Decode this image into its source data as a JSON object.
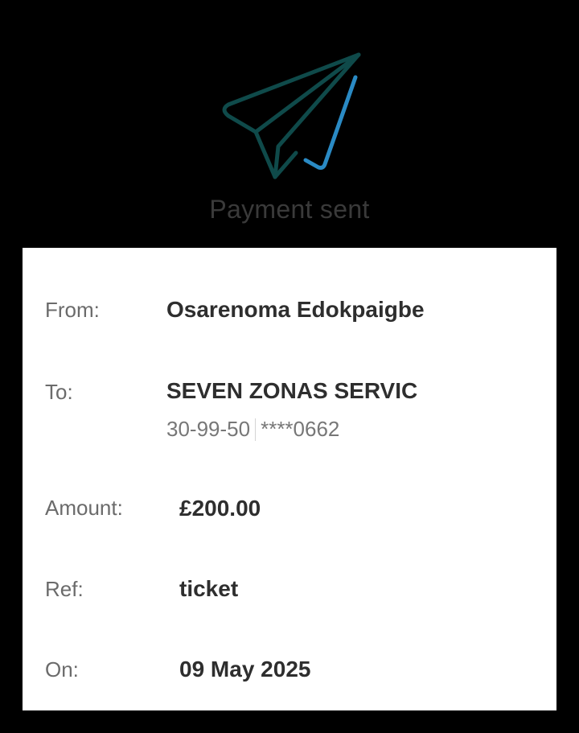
{
  "header": {
    "title": "Payment sent",
    "icon": "paper-plane-check-icon",
    "colors": {
      "plane": "#0f4a4a",
      "check": "#2a8ac4"
    }
  },
  "details": {
    "from_label": "From:",
    "from_value": "Osarenoma Edokpaigbe",
    "to_label": "To:",
    "to_value": "SEVEN ZONAS SERVIC",
    "sort_code": "30-99-50",
    "account_masked": "****0662",
    "amount_label": "Amount:",
    "amount_value": "£200.00",
    "ref_label": "Ref:",
    "ref_value": "ticket",
    "date_label": "On:",
    "date_value": "09 May 2025"
  }
}
